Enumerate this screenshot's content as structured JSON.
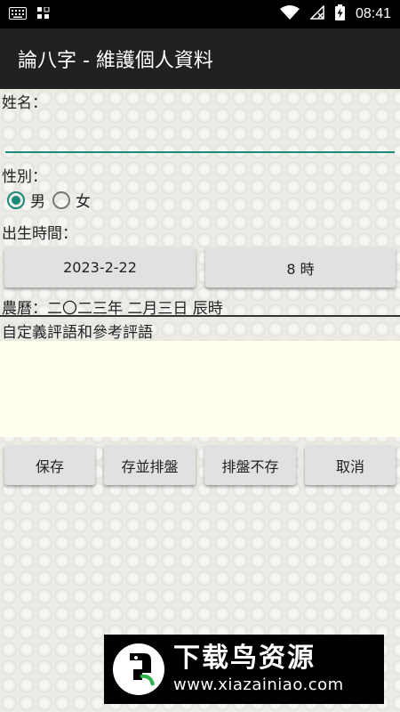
{
  "status_bar": {
    "time": "08:41"
  },
  "app_bar": {
    "title": "論八字 - 維護個人資料"
  },
  "form": {
    "name_label": "姓名：",
    "name_value": "",
    "gender_label": "性別：",
    "gender_options": [
      "男",
      "女"
    ],
    "gender_selected": "男",
    "birth_label": "出生時間：",
    "date_button": "2023-2-22",
    "hour_button": "8 時",
    "lunar_text": "農曆：二〇二三年 二月三日 辰時",
    "comment_label": "自定義評語和參考評語",
    "comment_value": ""
  },
  "actions": {
    "save": "保存",
    "save_and_chart": "存並排盤",
    "chart_no_save": "排盤不存",
    "cancel": "取消"
  },
  "watermark": {
    "title": "下载鸟资源",
    "url": "www.xiazainiao.com"
  },
  "colors": {
    "accent": "#1b8a7a",
    "app_bar": "#212121",
    "comment_bg": "#ffffec"
  }
}
